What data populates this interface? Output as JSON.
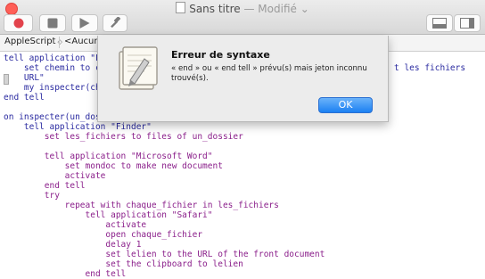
{
  "window": {
    "title": "Sans titre",
    "modified_label": "— Modifié",
    "modified_chevron": "⌄"
  },
  "toolbar": {
    "record_icon": "record-icon",
    "stop_icon": "stop-icon",
    "run_icon": "run-icon",
    "compile_icon": "hammer-icon",
    "layout_icons": [
      "split-view-icon",
      "sidebar-icon"
    ]
  },
  "navbar": {
    "language": "AppleScript",
    "language_arrows": "◇",
    "element": "<Aucune",
    "element_arrows": ""
  },
  "script": {
    "lines": [
      "tell application \"F",
      "    set chemin to c",
      "    URL\"",
      "    my inspecter(ch",
      "end tell",
      "",
      "on inspecter(un_dos",
      "    tell application \"Finder\"",
      "        set les_fichiers to files of un_dossier",
      "",
      "        tell application \"Microsoft Word\"",
      "            set mondoc to make new document",
      "            activate",
      "        end tell",
      "        try",
      "            repeat with chaque_fichier in les_fichiers",
      "                tell application \"Safari\"",
      "                    activate",
      "                    open chaque_fichier",
      "                    delay 1",
      "                    set lelien to the URL of the front document",
      "                    set the clipboard to lelien",
      "                end tell"
    ],
    "overflow_right": "t les fichiers"
  },
  "dialog": {
    "title": "Erreur de syntaxe",
    "message": "« end » ou « end tell » prévu(s) mais jeton inconnu trouvé(s).",
    "ok_label": "OK",
    "icon": "script-editor-icon"
  },
  "colors": {
    "keyword": "#2a2aa0",
    "purple_text": "#8a1e8a",
    "accent_blue": "#1b80f2",
    "close_red": "#ff5f57"
  }
}
